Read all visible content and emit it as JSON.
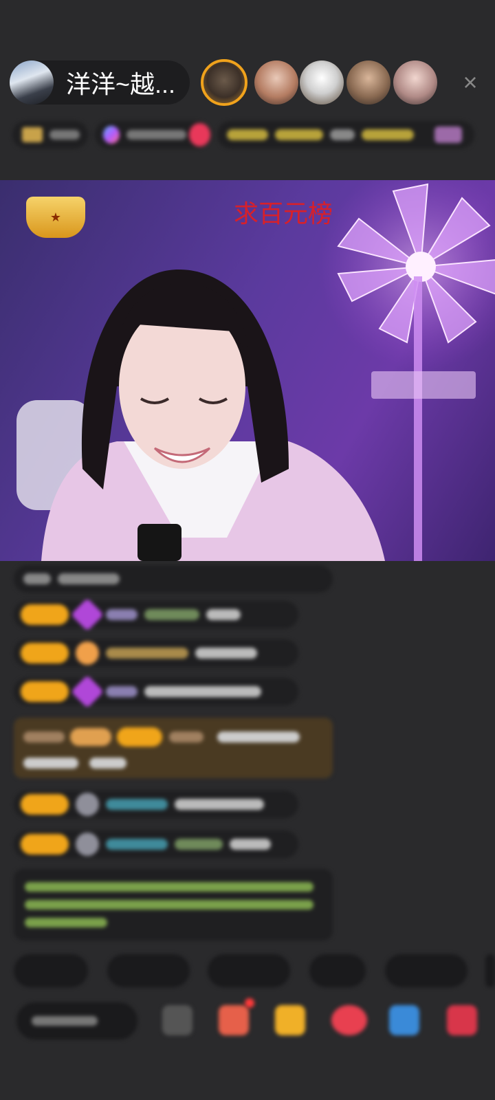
{
  "header": {
    "host_name": "洋洋~越...",
    "close_symbol": "×"
  },
  "video": {
    "caption": "求百元榜"
  },
  "colors": {
    "level_badge": "#f0a51a",
    "accent_red": "#d8202a",
    "background": "#2a2a2c"
  }
}
